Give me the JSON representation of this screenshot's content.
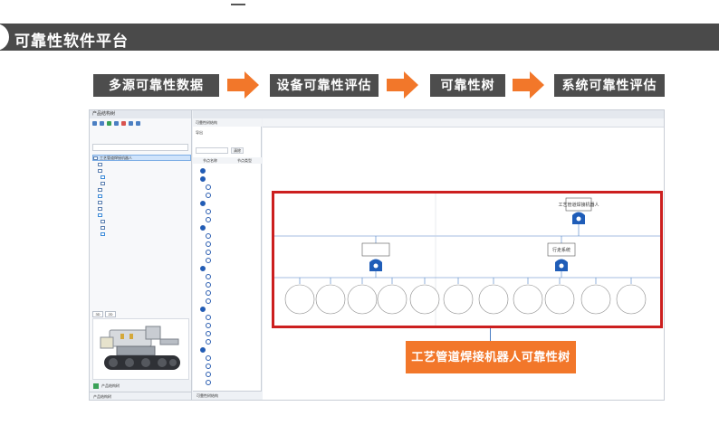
{
  "section": {
    "title": "可靠性软件平台"
  },
  "flow": {
    "steps": [
      "多源可靠性数据",
      "设备可靠性评估",
      "可靠性树",
      "系统可靠性评估"
    ],
    "arrow_color": "#f2772a"
  },
  "app": {
    "left_panel": {
      "title": "产品结构树",
      "search_placeholder": "",
      "tree_items": [
        {
          "label": "工艺管道焊接机器人",
          "selected": true
        },
        {
          "label": "",
          "selected": false
        },
        {
          "label": "",
          "selected": false
        },
        {
          "label": "",
          "selected": false
        },
        {
          "label": "",
          "selected": false
        },
        {
          "label": "",
          "selected": false
        },
        {
          "label": "",
          "selected": false
        },
        {
          "label": "",
          "selected": false
        },
        {
          "label": "",
          "selected": false
        },
        {
          "label": "",
          "selected": false
        },
        {
          "label": "",
          "selected": false
        },
        {
          "label": "",
          "selected": false
        },
        {
          "label": "",
          "selected": false
        }
      ],
      "view_tabs": [
        "3D",
        "2D"
      ],
      "footer_item": "产品结构树",
      "footer_tabs": [
        "产品结构树",
        ""
      ]
    },
    "mid_panel": {
      "doc_tab": "",
      "title": "可靠性树结构",
      "export_label": "导出",
      "search_placeholder": "",
      "search_button": "清除",
      "col_headers": [
        "节点名称",
        "节点类型"
      ],
      "rows": [
        {
          "label": "",
          "filled": true
        },
        {
          "label": "",
          "filled": true
        },
        {
          "label": "",
          "filled": false
        },
        {
          "label": "",
          "filled": false
        },
        {
          "label": "",
          "filled": true
        },
        {
          "label": "",
          "filled": false
        },
        {
          "label": "",
          "filled": false
        },
        {
          "label": "",
          "filled": true
        },
        {
          "label": "",
          "filled": false
        },
        {
          "label": "",
          "filled": false
        },
        {
          "label": "",
          "filled": false
        },
        {
          "label": "",
          "filled": false
        },
        {
          "label": "",
          "filled": true
        },
        {
          "label": "",
          "filled": false
        },
        {
          "label": "",
          "filled": false
        },
        {
          "label": "",
          "filled": false
        },
        {
          "label": "",
          "filled": false
        },
        {
          "label": "",
          "filled": true
        },
        {
          "label": "",
          "filled": false
        },
        {
          "label": "",
          "filled": false
        },
        {
          "label": "",
          "filled": false
        },
        {
          "label": "",
          "filled": false
        },
        {
          "label": "",
          "filled": true
        },
        {
          "label": "",
          "filled": false
        },
        {
          "label": "",
          "filled": false
        },
        {
          "label": "",
          "filled": false
        },
        {
          "label": "",
          "filled": false
        }
      ],
      "footer": "可靠性树结构"
    },
    "canvas": {
      "toolbar_left": [
        "",
        "",
        "",
        ""
      ],
      "toolbar_right": [
        "",
        "",
        ""
      ]
    }
  },
  "fault_tree": {
    "top_event": "工艺管道焊接机器人",
    "mid_events": [
      "",
      "行走系统"
    ],
    "leaf_events": [
      "",
      "",
      "",
      "",
      "",
      "",
      "",
      "",
      "",
      ""
    ],
    "colors": {
      "gate": "#1f5db8",
      "box_border": "#555555",
      "line": "#4a7fc4",
      "highlight": "#cc1f1f"
    }
  },
  "callout": {
    "text": "工艺管道焊接机器人可靠性树",
    "color": "#f2772a"
  }
}
